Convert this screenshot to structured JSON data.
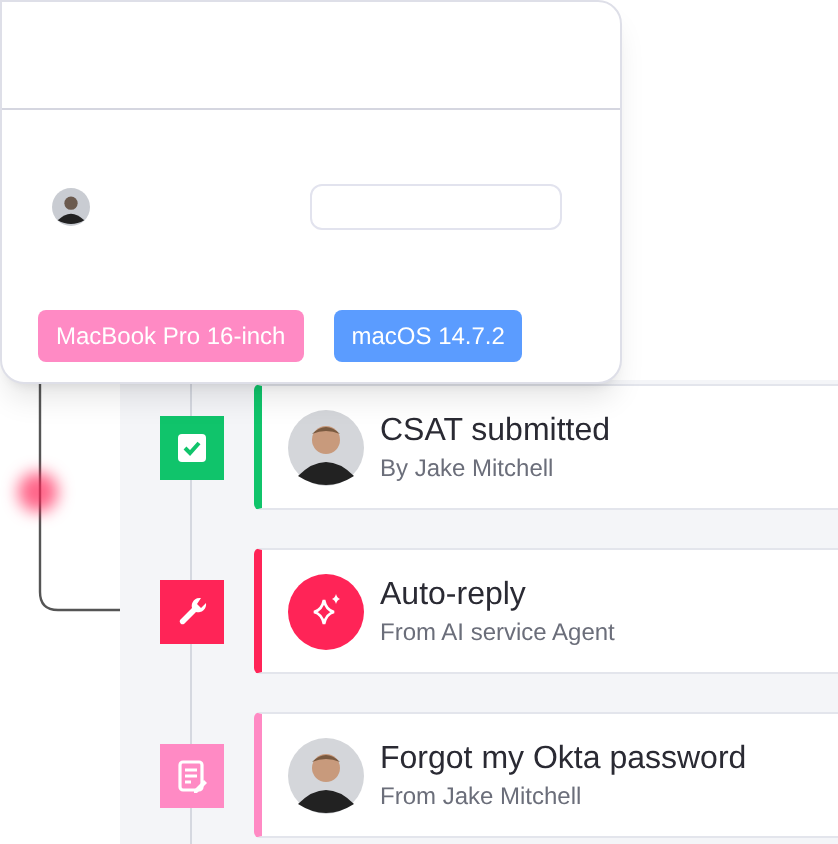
{
  "popup": {
    "badges": [
      {
        "label": "MacBook Pro 16-inch",
        "color": "#ff8ac4"
      },
      {
        "label": "macOS 14.7.2",
        "color": "#5b9cff"
      }
    ]
  },
  "timeline": [
    {
      "kind": "survey",
      "color": "#10c46b",
      "title": "CSAT submitted",
      "subtitle": "By Jake Mitchell"
    },
    {
      "kind": "automation",
      "color": "#ff2457",
      "title": "Auto-reply",
      "subtitle": "From AI service Agent"
    },
    {
      "kind": "ticket",
      "color": "#ff8ac4",
      "title": "Forgot my Okta password",
      "subtitle": "From Jake Mitchell"
    }
  ]
}
